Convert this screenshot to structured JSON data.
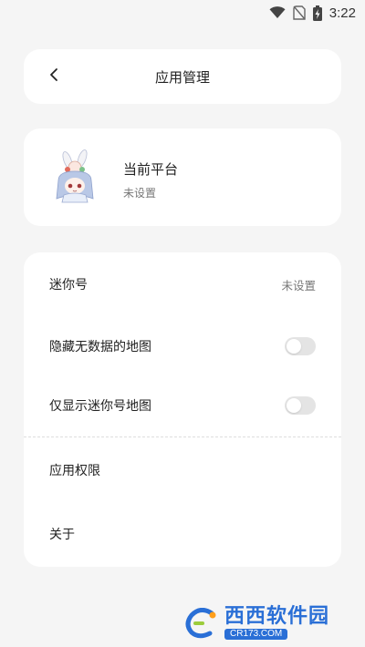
{
  "status_bar": {
    "time": "3:22",
    "icons": [
      "wifi-icon",
      "no-sim-icon",
      "battery-charging-icon"
    ]
  },
  "header": {
    "back_icon": "chevron-left-icon",
    "title": "应用管理"
  },
  "profile": {
    "name": "当前平台",
    "subtitle": "未设置",
    "avatar": "anime-character-avatar"
  },
  "settings": {
    "mini_id": {
      "label": "迷你号",
      "value": "未设置"
    },
    "hide_no_data_maps": {
      "label": "隐藏无数据的地图",
      "enabled": false
    },
    "show_mini_id_maps_only": {
      "label": "仅显示迷你号地图",
      "enabled": false
    },
    "app_permissions": {
      "label": "应用权限"
    },
    "about": {
      "label": "关于"
    }
  },
  "watermark": {
    "brand": "西西软件园",
    "url": "CR173.COM"
  },
  "colors": {
    "background": "#f5f5f5",
    "card": "#ffffff",
    "toggle_off": "#e4e4e4",
    "watermark_blue": "#2a6fd6"
  }
}
